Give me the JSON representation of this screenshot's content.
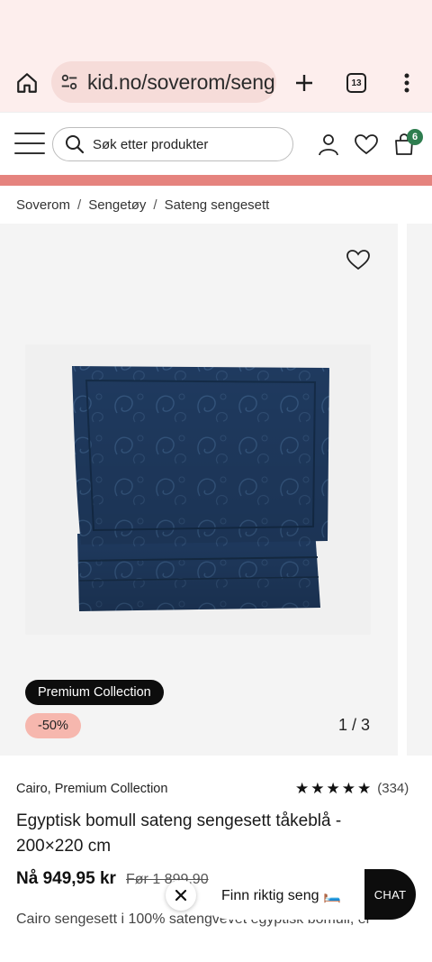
{
  "browser": {
    "url": "kid.no/soverom/seng",
    "tab_count": "13"
  },
  "header": {
    "search_placeholder": "Søk etter produkter",
    "cart_count": "6"
  },
  "breadcrumb": [
    {
      "label": "Soverom"
    },
    {
      "label": "Sengetøy"
    },
    {
      "label": "Sateng sengesett"
    }
  ],
  "gallery": {
    "premium_badge": "Premium Collection",
    "discount_badge": "-50%",
    "counter": "1 / 3"
  },
  "product": {
    "brand_line": "Cairo, Premium Collection",
    "rating_stars": 5,
    "review_count": "(334)",
    "title": "Egyptisk bomull sateng sengesett tåkeblå - 200×220 cm",
    "price_now": "Nå 949,95 kr",
    "price_before": "Før 1 899,90",
    "description": "Cairo sengesett i 100% satengvevet egyptisk bomull, er"
  },
  "finder": {
    "label": "Finn riktig seng 🛏️",
    "chat_label": "CHAT"
  },
  "colors": {
    "promo_strip": "#e5837e",
    "discount_badge": "#f6b7ae",
    "cart_badge": "#2e7d4f",
    "browser_bar": "#fdeeed",
    "product_fabric": "#1f3a5f"
  }
}
